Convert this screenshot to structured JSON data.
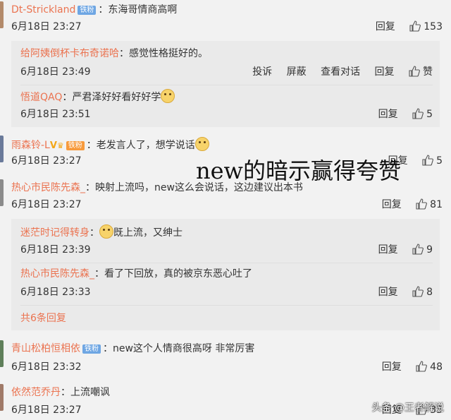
{
  "comments": [
    {
      "user": "Dt-Strickland",
      "badge": "铁粉",
      "text": "：东海哥情商高啊",
      "date": "6月18日 23:27",
      "reply": "回复",
      "likes": "153"
    },
    {
      "user": "雨森铃-L",
      "badge": "铁粉",
      "text": "：老发言人了，想学说话",
      "date": "6月18日 23:27",
      "reply": "回复",
      "likes": "5"
    },
    {
      "user": "热心市民陈先森_",
      "text": "：映射上流吗，new这么会说话，这边建议出本书",
      "date": "6月18日 23:27",
      "reply": "回复",
      "likes": "81"
    },
    {
      "user": "青山松柏恒相依",
      "badge": "铁粉",
      "text": "：new这个人情商很高呀 非常厉害",
      "date": "6月18日 23:32",
      "reply": "回复",
      "likes": "48"
    },
    {
      "user": "依然范乔丹",
      "text": "：上流嘲讽",
      "date": "6月18日 23:27",
      "reply": "回复",
      "likes": "33"
    }
  ],
  "replies1": [
    {
      "user": "给阿姨倒杯卡布奇诺哈",
      "text": "：感觉性格挺好的。",
      "date": "6月18日 23:49",
      "report": "投诉",
      "block": "屏蔽",
      "view": "查看对话",
      "reply": "回复",
      "like_label": "赞"
    },
    {
      "user": "悟道QAQ",
      "text": "：严君泽好好看好好学",
      "date": "6月18日 23:51",
      "reply": "回复",
      "likes": "5"
    }
  ],
  "replies2": [
    {
      "user": "迷茫时记得转身",
      "text": "既上流，又绅士",
      "date": "6月18日 23:39",
      "reply": "回复",
      "likes": "9"
    },
    {
      "user": "热心市民陈先森_",
      "text": "：看了下回放，真的被京东恶心吐了",
      "date": "6月18日 23:33",
      "reply": "回复",
      "likes": "8"
    }
  ],
  "more_replies": "共6条回复",
  "overlay": "new的暗示赢得夸赞",
  "watermark": "头条 @王者解说",
  "colors": {
    "username": "#eb7350",
    "badge_blue": "#6ea6e3",
    "badge_orange": "#f79a3c",
    "background": "#f2f2f2",
    "reply_box": "#eaeaea"
  }
}
